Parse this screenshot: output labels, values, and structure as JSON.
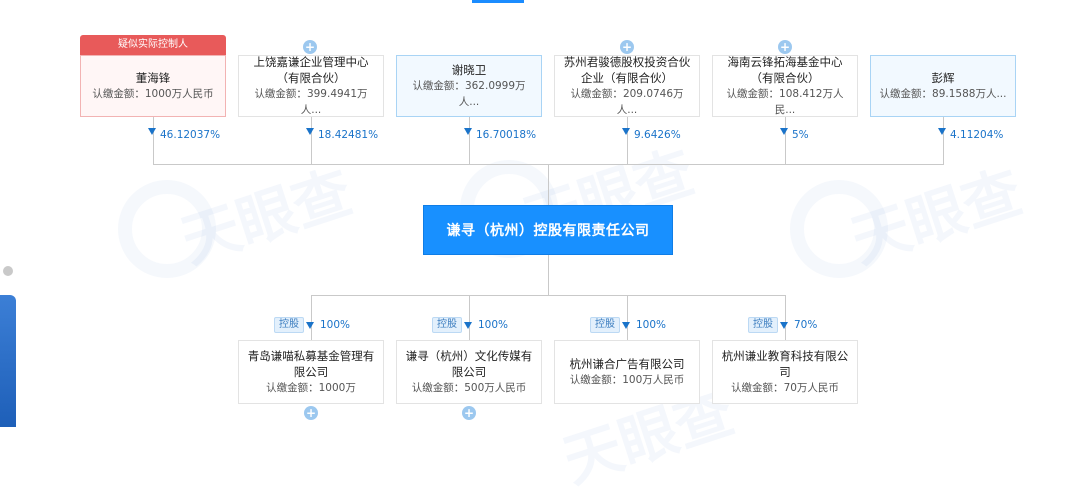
{
  "top_badge": "疑似实际控制人",
  "shareholders": [
    {
      "name": "董海锋",
      "amount_label": "认缴金额：",
      "amount": "1000万人民币",
      "percent": "46.12037%"
    },
    {
      "name": "上饶嘉谦企业管理中心（有限合伙）",
      "amount_label": "认缴金额：",
      "amount": "399.4941万人...",
      "percent": "18.42481%"
    },
    {
      "name": "谢晓卫",
      "amount_label": "认缴金额：",
      "amount": "362.0999万人...",
      "percent": "16.70018%"
    },
    {
      "name": "苏州君骏德股权投资合伙企业（有限合伙）",
      "amount_label": "认缴金额：",
      "amount": "209.0746万人...",
      "percent": "9.6426%"
    },
    {
      "name": "海南云锋拓海基金中心（有限合伙）",
      "amount_label": "认缴金额：",
      "amount": "108.412万人民...",
      "percent": "5%"
    },
    {
      "name": "彭辉",
      "amount_label": "认缴金额：",
      "amount": "89.1588万人...",
      "percent": "4.11204%"
    }
  ],
  "company": {
    "name": "谦寻（杭州）控股有限责任公司"
  },
  "subsidiaries": [
    {
      "tag": "控股",
      "percent": "100%",
      "name": "青岛谦喵私募基金管理有限公司",
      "amount_label": "认缴金额：",
      "amount": "1000万"
    },
    {
      "tag": "控股",
      "percent": "100%",
      "name": "谦寻（杭州）文化传媒有限公司",
      "amount_label": "认缴金额：",
      "amount": "500万人民币"
    },
    {
      "tag": "控股",
      "percent": "100%",
      "name": "杭州谦合广告有限公司",
      "amount_label": "认缴金额：",
      "amount": "100万人民币"
    },
    {
      "tag": "控股",
      "percent": "70%",
      "name": "杭州谦业教育科技有限公司",
      "amount_label": "认缴金额：",
      "amount": "70万人民币"
    }
  ],
  "icons": {
    "expand": "plus-circle-icon",
    "arrow": "arrow-down-icon"
  },
  "colors": {
    "accent": "#1890ff",
    "badge": "#e85a5a",
    "percent": "#1a73c9"
  }
}
